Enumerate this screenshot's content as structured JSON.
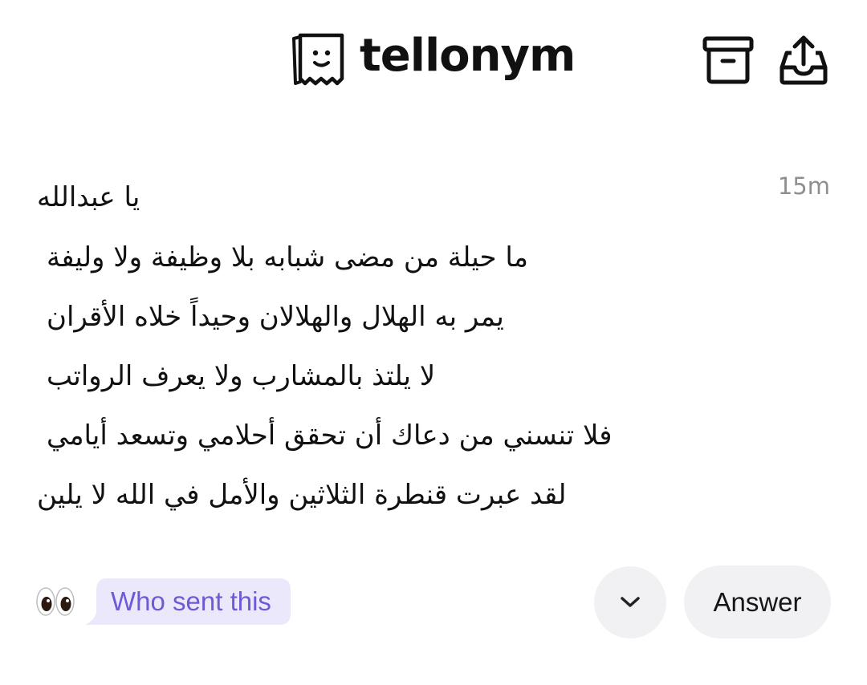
{
  "header": {
    "brand": "tellonym",
    "icons": {
      "logo": "tellonym-logo-icon",
      "archive": "archive-box-icon",
      "share": "share-tray-icon"
    }
  },
  "tell": {
    "time": "15m",
    "lines": [
      "يا عبدالله",
      "ما حيلة من مضى شبابه بلا وظيفة ولا وليفة",
      "يمر به الهلال والهلالان وحيداً خلاه الأقران",
      "لا يلتذ بالمشارب ولا يعرف الرواتب",
      "فلا تنسني من دعاك أن تحقق أحلامي وتسعد أيامي",
      "لقد عبرت قنطرة الثلاثين والأمل في الله لا يلين"
    ]
  },
  "actions": {
    "eyes_icon": "eyes-emoji-icon",
    "who_sent": "Who sent this",
    "expand_icon": "chevron-down-icon",
    "answer": "Answer"
  },
  "colors": {
    "who_text": "#6d5ad6",
    "who_bg": "#ece8fb",
    "button_bg": "#f1f1f4",
    "time": "#8f8f8f"
  }
}
